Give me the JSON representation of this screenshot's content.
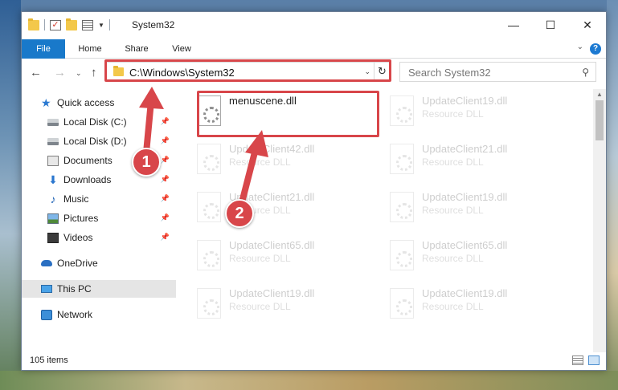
{
  "window": {
    "title": "System32",
    "controls": {
      "minimize": "—",
      "maximize": "☐",
      "close": "✕"
    }
  },
  "ribbon": {
    "tabs": [
      {
        "label": "File",
        "active": true
      },
      {
        "label": "Home"
      },
      {
        "label": "Share"
      },
      {
        "label": "View"
      }
    ],
    "help": "?"
  },
  "address": {
    "path": "C:\\Windows\\System32",
    "search_placeholder": "Search System32"
  },
  "sidebar": {
    "items": [
      {
        "label": "Quick access",
        "icon": "star-icon"
      },
      {
        "label": "Local Disk (C:)",
        "icon": "disk-icon",
        "pinned": true
      },
      {
        "label": "Local Disk (D:)",
        "icon": "disk-icon",
        "pinned": true
      },
      {
        "label": "Documents",
        "icon": "documents-icon",
        "pinned": true
      },
      {
        "label": "Downloads",
        "icon": "download-icon",
        "pinned": true
      },
      {
        "label": "Music",
        "icon": "music-icon",
        "pinned": true
      },
      {
        "label": "Pictures",
        "icon": "pictures-icon",
        "pinned": true
      },
      {
        "label": "Videos",
        "icon": "videos-icon",
        "pinned": true
      },
      {
        "label": "OneDrive",
        "icon": "onedrive-icon"
      },
      {
        "label": "This PC",
        "icon": "this-pc-icon",
        "selected": true
      },
      {
        "label": "Network",
        "icon": "network-icon"
      }
    ]
  },
  "files": {
    "highlighted": {
      "name": "menuscene.dll",
      "type": ""
    },
    "faded": [
      {
        "name": "UpdateClient19.dll",
        "type": "Resource DLL"
      },
      {
        "name": "UpdateClient42.dll",
        "type": "Resource DLL"
      },
      {
        "name": "UpdateClient21.dll",
        "type": "Resource DLL"
      },
      {
        "name": "UpdateClient21.dll",
        "type": "Resource DLL"
      },
      {
        "name": "UpdateClient19.dll",
        "type": "Resource DLL"
      },
      {
        "name": "UpdateClient65.dll",
        "type": "Resource DLL"
      },
      {
        "name": "UpdateClient65.dll",
        "type": "Resource DLL"
      },
      {
        "name": "UpdateClient19.dll",
        "type": "Resource DLL"
      },
      {
        "name": "UpdateClient19.dll",
        "type": "Resource DLL"
      }
    ]
  },
  "status": {
    "item_count": "105 items"
  },
  "annotations": {
    "step1": "1",
    "step2": "2",
    "color": "#d8464a"
  }
}
